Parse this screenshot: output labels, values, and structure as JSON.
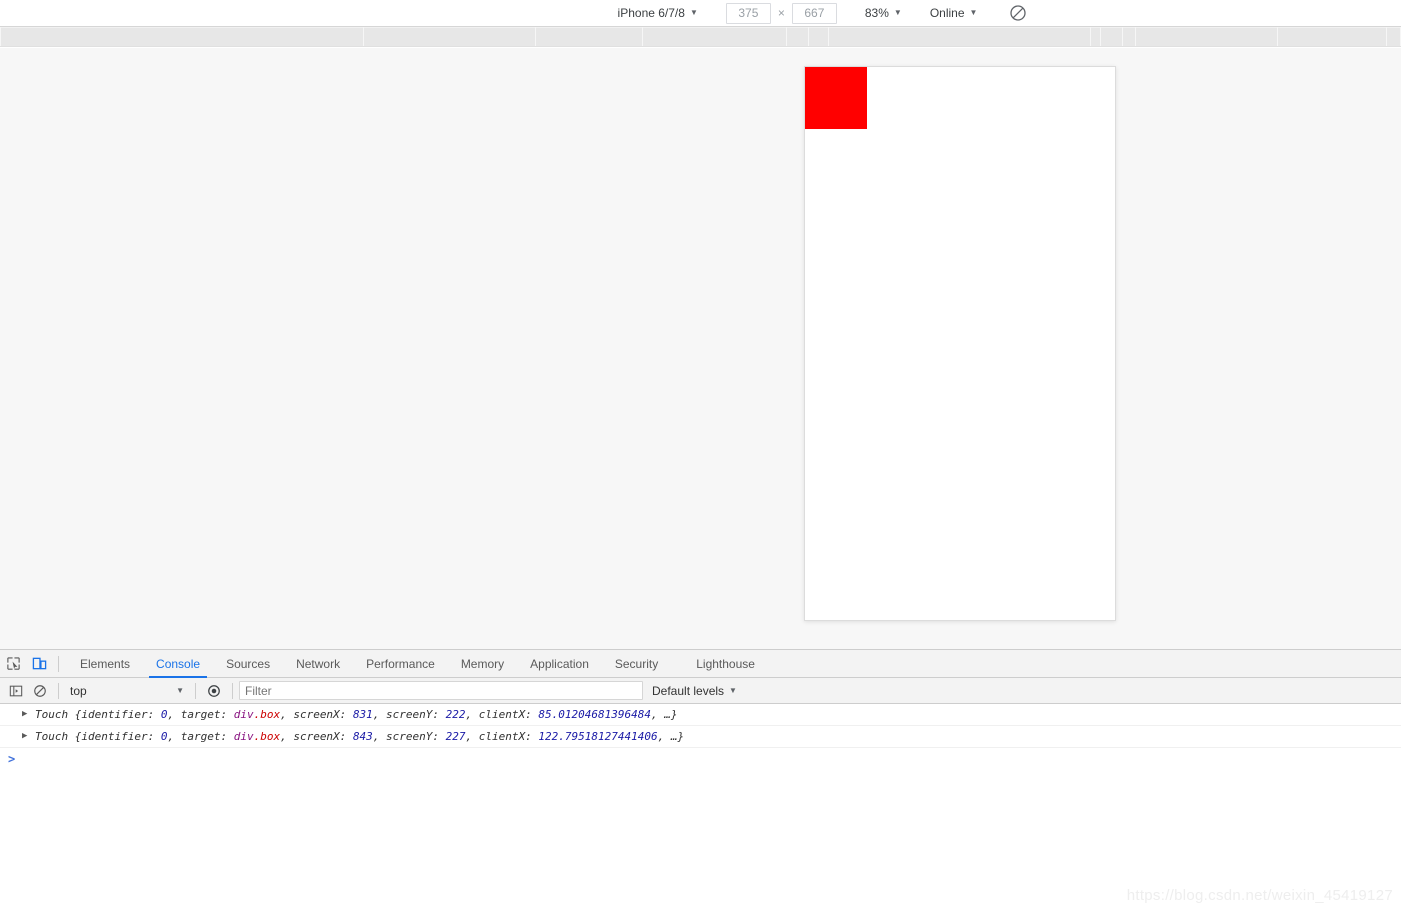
{
  "device_toolbar": {
    "device_name": "iPhone 6/7/8",
    "width": "375",
    "height": "667",
    "times_symbol": "×",
    "zoom": "83%",
    "network": "Online",
    "caret": "▼",
    "rotate_icon": "rotate-device-icon"
  },
  "viewport": {
    "box_color": "#ff0000",
    "box_name": "div.box",
    "background": "#ffffff"
  },
  "devtools": {
    "icons": {
      "inspect": "inspect-element-icon",
      "device_toggle": "toggle-device-toolbar-icon"
    },
    "tabs": [
      {
        "label": "Elements",
        "active": false
      },
      {
        "label": "Console",
        "active": true
      },
      {
        "label": "Sources",
        "active": false
      },
      {
        "label": "Network",
        "active": false
      },
      {
        "label": "Performance",
        "active": false
      },
      {
        "label": "Memory",
        "active": false
      },
      {
        "label": "Application",
        "active": false
      },
      {
        "label": "Security",
        "active": false
      },
      {
        "label": "Lighthouse",
        "active": false
      }
    ],
    "console_toolbar": {
      "sidebar_icon": "console-sidebar-icon",
      "clear_icon": "clear-console-icon",
      "context": "top",
      "context_caret": "▼",
      "eye_icon": "live-expression-eye-icon",
      "filter_placeholder": "Filter",
      "levels": "Default levels",
      "levels_caret": "▼"
    },
    "console_entries": [
      {
        "triangle": "▶",
        "prefix": "Touch {identifier: ",
        "identifier": "0",
        "target_label": ", target: ",
        "target_tag": "div",
        "target_class": ".box",
        "screenx_label": ", screenX: ",
        "screenx": "831",
        "screeny_label": ", screenY: ",
        "screeny": "222",
        "clientx_label": ", clientX: ",
        "clientx": "85.01204681396484",
        "suffix": ", …}"
      },
      {
        "triangle": "▶",
        "prefix": "Touch {identifier: ",
        "identifier": "0",
        "target_label": ", target: ",
        "target_tag": "div",
        "target_class": ".box",
        "screenx_label": ", screenX: ",
        "screenx": "843",
        "screeny_label": ", screenY: ",
        "screeny": "227",
        "clientx_label": ", clientX: ",
        "clientx": "122.79518127441406",
        "suffix": ", …}"
      }
    ],
    "prompt": ">"
  },
  "watermark": "https://blog.csdn.net/weixin_45419127"
}
